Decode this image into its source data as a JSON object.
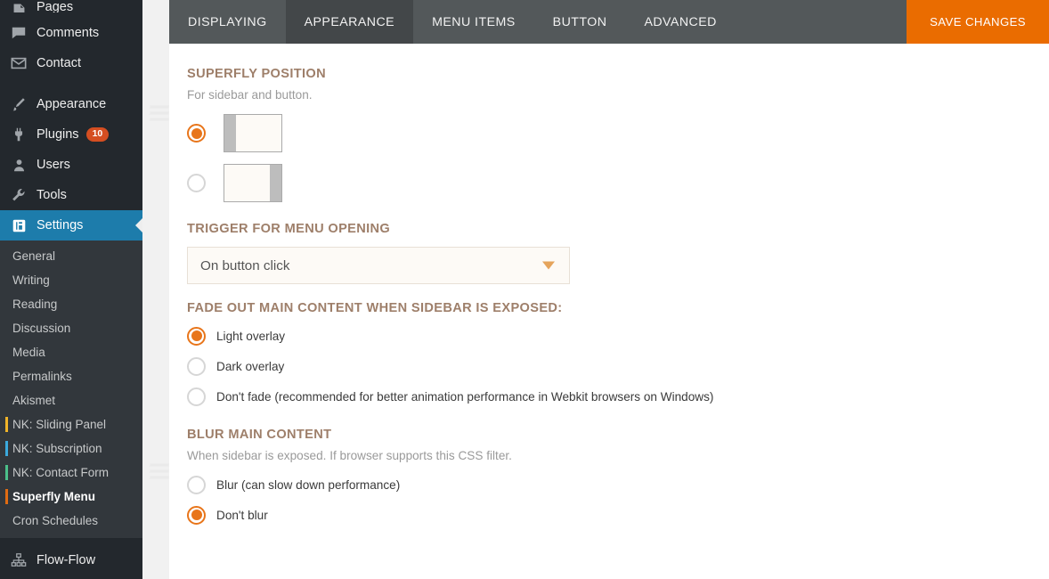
{
  "sidebar": {
    "top_items": [
      {
        "label": "Pages",
        "icon": "pages-icon",
        "partial": true,
        "badge": null
      },
      {
        "label": "Comments",
        "icon": "comments-icon",
        "partial": false,
        "badge": null
      },
      {
        "label": "Contact",
        "icon": "mail-icon",
        "partial": false,
        "badge": null
      }
    ],
    "group_two": [
      {
        "label": "Appearance",
        "icon": "brush-icon",
        "badge": null,
        "current": false
      },
      {
        "label": "Plugins",
        "icon": "plug-icon",
        "badge": "10",
        "current": false
      },
      {
        "label": "Users",
        "icon": "user-icon",
        "badge": null,
        "current": false
      },
      {
        "label": "Tools",
        "icon": "wrench-icon",
        "badge": null,
        "current": false
      },
      {
        "label": "Settings",
        "icon": "settings-icon",
        "badge": null,
        "current": true
      }
    ],
    "submenu": [
      {
        "label": "General",
        "bar": null,
        "active": false
      },
      {
        "label": "Writing",
        "bar": null,
        "active": false
      },
      {
        "label": "Reading",
        "bar": null,
        "active": false
      },
      {
        "label": "Discussion",
        "bar": null,
        "active": false
      },
      {
        "label": "Media",
        "bar": null,
        "active": false
      },
      {
        "label": "Permalinks",
        "bar": null,
        "active": false
      },
      {
        "label": "Akismet",
        "bar": null,
        "active": false
      },
      {
        "label": "NK: Sliding Panel",
        "bar": "#f0b429",
        "active": false
      },
      {
        "label": "NK: Subscription",
        "bar": "#3ba9dd",
        "active": false
      },
      {
        "label": "NK: Contact Form",
        "bar": "#4bbf8a",
        "active": false
      },
      {
        "label": "Superfly Menu",
        "bar": "#e06c12",
        "active": true
      },
      {
        "label": "Cron Schedules",
        "bar": null,
        "active": false
      }
    ],
    "bottom_items": [
      {
        "label": "Flow-Flow",
        "icon": "sitemap-icon"
      }
    ],
    "current_color": "#1d7cab"
  },
  "tabs": [
    {
      "label": "DISPLAYING",
      "active": false
    },
    {
      "label": "APPEARANCE",
      "active": true
    },
    {
      "label": "MENU ITEMS",
      "active": false
    },
    {
      "label": "BUTTON",
      "active": false
    },
    {
      "label": "ADVANCED",
      "active": false
    }
  ],
  "save_button": {
    "label": "SAVE CHANGES",
    "color": "#ea6c00"
  },
  "sections": {
    "position": {
      "title": "SUPERFLY POSITION",
      "description": "For sidebar and button.",
      "options": [
        {
          "id": "left",
          "align": "left",
          "selected": true
        },
        {
          "id": "right",
          "align": "right",
          "selected": false
        }
      ]
    },
    "trigger": {
      "title": "TRIGGER FOR MENU OPENING",
      "selected_value": "On button click"
    },
    "fade": {
      "title": "FADE OUT MAIN CONTENT WHEN SIDEBAR IS EXPOSED:",
      "options": [
        {
          "label": "Light overlay",
          "selected": true
        },
        {
          "label": "Dark overlay",
          "selected": false
        },
        {
          "label": "Don't fade (recommended for better animation performance in Webkit browsers on Windows)",
          "selected": false
        }
      ]
    },
    "blur": {
      "title": "BLUR MAIN CONTENT",
      "description": "When sidebar is exposed. If browser supports this CSS filter.",
      "options": [
        {
          "label": "Blur (can slow down performance)",
          "selected": false
        },
        {
          "label": "Don't blur",
          "selected": true
        }
      ]
    }
  },
  "theme": {
    "accent_orange": "#e8751a",
    "heading_brown": "#9e7f6a",
    "tabbar_gray": "#53588a",
    "sidebar_dark": "#23282d",
    "submenu_dark": "#32373c"
  }
}
